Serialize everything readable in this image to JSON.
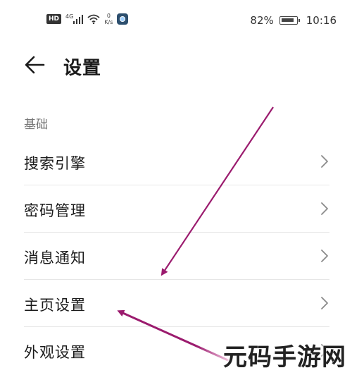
{
  "status_bar": {
    "hd_badge": "HD",
    "network_type": "4G",
    "speed_value": "0",
    "speed_unit": "K/s",
    "battery_percent": "82%",
    "time": "10:16",
    "icons": [
      "hd-icon",
      "signal-icon",
      "wifi-icon",
      "camera-app-icon",
      "battery-charging-icon"
    ]
  },
  "header": {
    "back_icon": "arrow-left-icon",
    "title": "设置"
  },
  "section": {
    "label": "基础",
    "items": [
      {
        "label": "搜索引擎"
      },
      {
        "label": "密码管理"
      },
      {
        "label": "消息通知"
      },
      {
        "label": "主页设置"
      },
      {
        "label": "外观设置"
      }
    ]
  },
  "colors": {
    "annotation_arrow": "#9b1b6e",
    "divider": "#e6e6e6",
    "section_label": "#777777"
  },
  "watermark": "元码手游网"
}
